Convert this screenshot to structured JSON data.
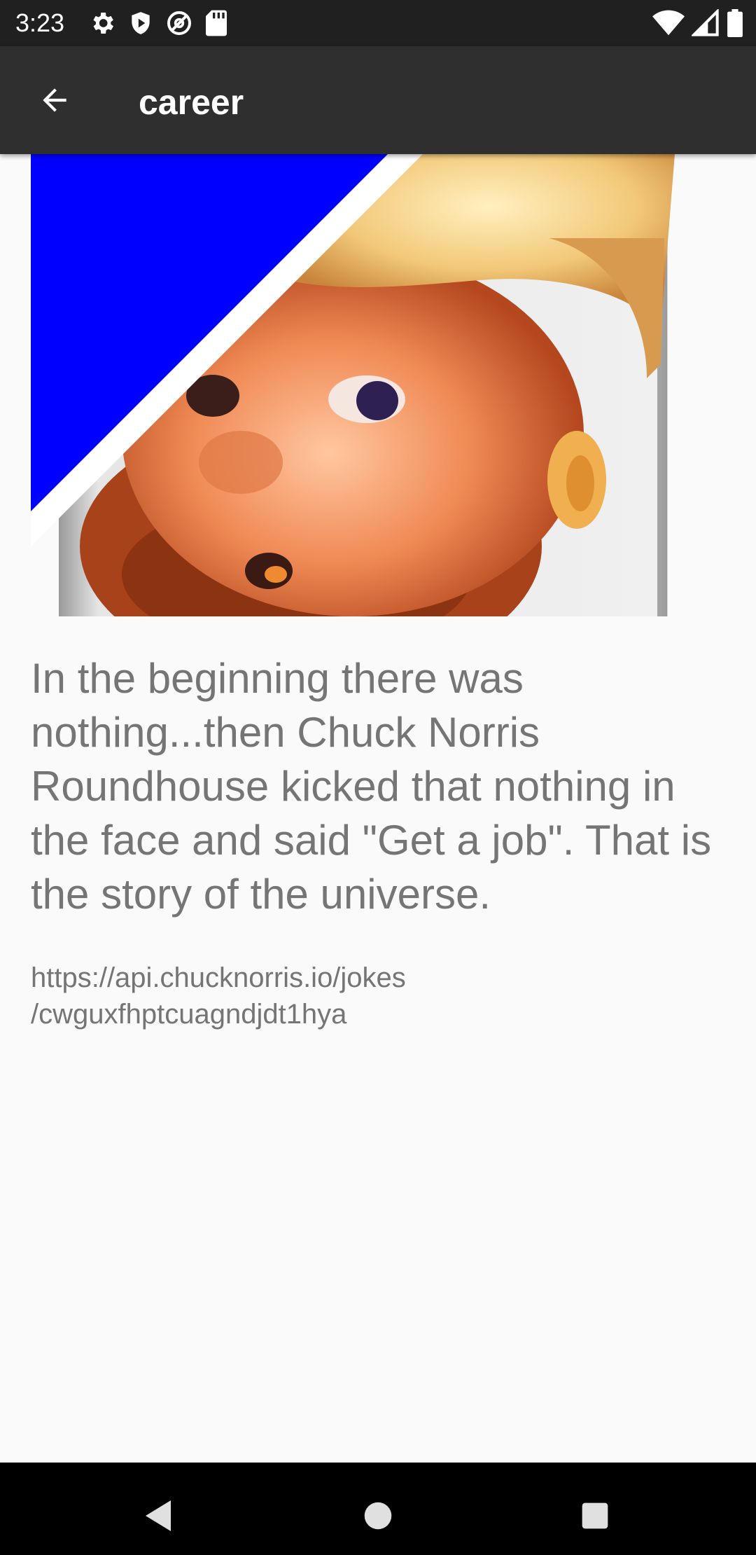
{
  "status_bar": {
    "time": "3:23",
    "left_icons": [
      "settings-icon",
      "shield-play-icon",
      "at-sync-icon",
      "sd-card-icon"
    ],
    "right_icons": [
      "wifi-icon",
      "cell-signal-icon",
      "battery-icon"
    ]
  },
  "app_bar": {
    "back_icon": "arrow-left-icon",
    "title": "career"
  },
  "joke": {
    "image_description_icon": "chuck-norris-avatar",
    "text": "In the beginning there was nothing...then Chuck Norris Roundhouse kicked that nothing in the face and said \"Get a job\". That is the story of the universe.",
    "url_line1": "https://api.chucknorris.io/jokes",
    "url_line2": "/cwguxfhptcuagndjdt1hya"
  },
  "colors": {
    "status_bar_bg": "#202020",
    "app_bar_bg": "#2f2f30",
    "page_bg": "#fafafa",
    "text_gray": "#757575",
    "corner_ribbon": "#0000ff",
    "nav_bar_bg": "#000000"
  },
  "nav_bar": {
    "icons": [
      "nav-back-icon",
      "nav-home-icon",
      "nav-recents-icon"
    ]
  }
}
